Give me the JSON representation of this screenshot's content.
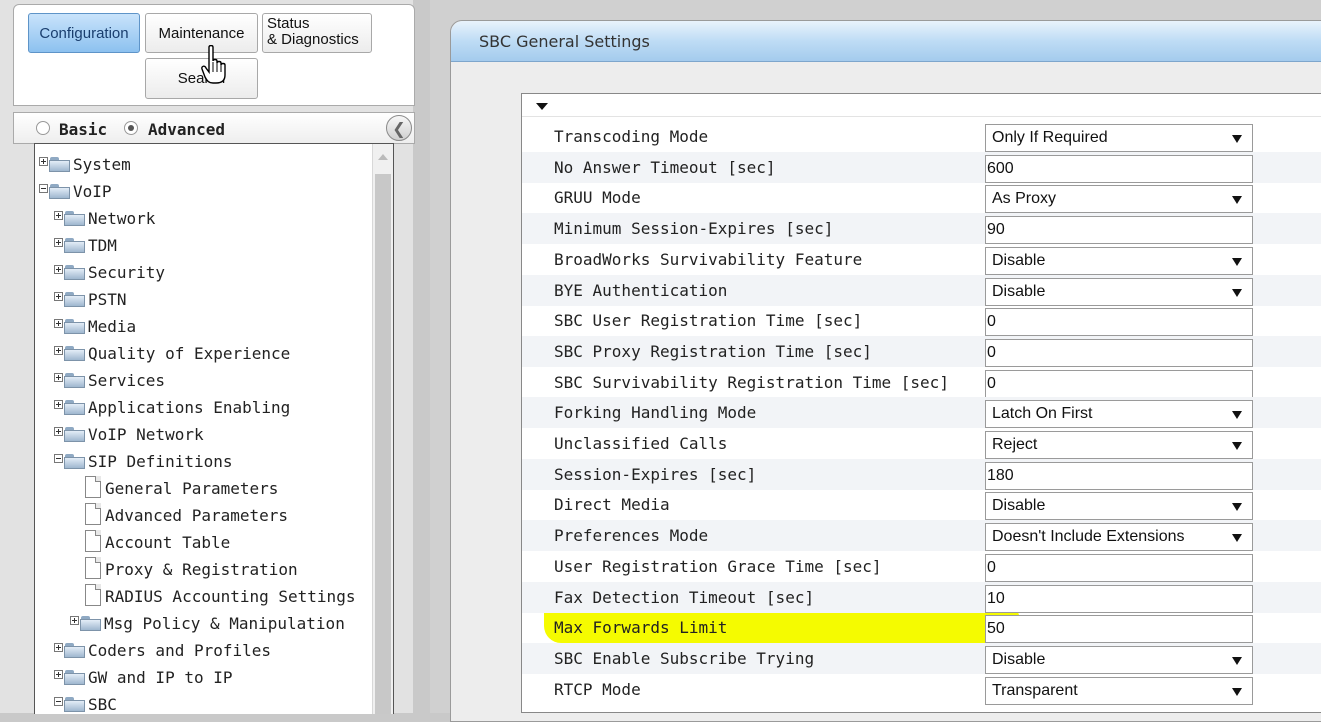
{
  "nav": {
    "configuration": "Configuration",
    "maintenance": "Maintenance",
    "status_line1": "Status",
    "status_line2": "& Diagnostics",
    "search": "Search"
  },
  "mode": {
    "basic": "Basic",
    "advanced": "Advanced",
    "selected": "Advanced"
  },
  "tree": {
    "items": [
      {
        "label": "System",
        "type": "folder",
        "expander": "plus",
        "level": 0
      },
      {
        "label": "VoIP",
        "type": "folder",
        "expander": "minus",
        "level": 0
      },
      {
        "label": "Network",
        "type": "folder",
        "expander": "plus",
        "level": 1
      },
      {
        "label": "TDM",
        "type": "folder",
        "expander": "plus",
        "level": 1
      },
      {
        "label": "Security",
        "type": "folder",
        "expander": "plus",
        "level": 1
      },
      {
        "label": "PSTN",
        "type": "folder",
        "expander": "plus",
        "level": 1
      },
      {
        "label": "Media",
        "type": "folder",
        "expander": "plus",
        "level": 1
      },
      {
        "label": "Quality of Experience",
        "type": "folder",
        "expander": "plus",
        "level": 1
      },
      {
        "label": "Services",
        "type": "folder",
        "expander": "plus",
        "level": 1
      },
      {
        "label": "Applications Enabling",
        "type": "folder",
        "expander": "plus",
        "level": 1
      },
      {
        "label": "VoIP Network",
        "type": "folder",
        "expander": "plus",
        "level": 1
      },
      {
        "label": "SIP Definitions",
        "type": "folder",
        "expander": "minus",
        "level": 1
      },
      {
        "label": "General Parameters",
        "type": "page",
        "level": 2
      },
      {
        "label": "Advanced Parameters",
        "type": "page",
        "level": 2
      },
      {
        "label": "Account Table",
        "type": "page",
        "level": 2
      },
      {
        "label": "Proxy & Registration",
        "type": "page",
        "level": 2
      },
      {
        "label": "RADIUS Accounting Settings",
        "type": "page",
        "level": 2
      },
      {
        "label": "Msg Policy & Manipulation",
        "type": "folder",
        "expander": "plus",
        "level": 2
      },
      {
        "label": "Coders and Profiles",
        "type": "folder",
        "expander": "plus",
        "level": 1
      },
      {
        "label": "GW and IP to IP",
        "type": "folder",
        "expander": "plus",
        "level": 1
      },
      {
        "label": "SBC",
        "type": "folder",
        "expander": "minus",
        "level": 1
      }
    ]
  },
  "settings": {
    "title": "SBC General Settings",
    "rows": [
      {
        "label": "Transcoding Mode",
        "control": "select",
        "value": "Only If Required"
      },
      {
        "label": "No Answer Timeout [sec]",
        "control": "input",
        "value": "600"
      },
      {
        "label": "GRUU Mode",
        "control": "select",
        "value": "As Proxy"
      },
      {
        "label": "Minimum Session-Expires [sec]",
        "control": "input",
        "value": "90"
      },
      {
        "label": "BroadWorks Survivability Feature",
        "control": "select",
        "value": "Disable"
      },
      {
        "label": "BYE Authentication",
        "control": "select",
        "value": "Disable"
      },
      {
        "label": "SBC User Registration Time [sec]",
        "control": "input",
        "value": "0"
      },
      {
        "label": "SBC Proxy Registration Time [sec]",
        "control": "input",
        "value": "0"
      },
      {
        "label": "SBC Survivability Registration Time [sec]",
        "control": "input",
        "value": "0"
      },
      {
        "label": "Forking Handling Mode",
        "control": "select",
        "value": "Latch On First"
      },
      {
        "label": "Unclassified Calls",
        "control": "select",
        "value": "Reject"
      },
      {
        "label": "Session-Expires [sec]",
        "control": "input",
        "value": "180"
      },
      {
        "label": "Direct Media",
        "control": "select",
        "value": "Disable"
      },
      {
        "label": "Preferences Mode",
        "control": "select",
        "value": "Doesn't Include Extensions"
      },
      {
        "label": "User Registration Grace Time [sec]",
        "control": "input",
        "value": "0"
      },
      {
        "label": "Fax Detection Timeout [sec]",
        "control": "input",
        "value": "10"
      },
      {
        "label": "Max Forwards Limit",
        "control": "input",
        "value": "50"
      },
      {
        "label": "SBC Enable Subscribe Trying",
        "control": "select",
        "value": "Disable"
      },
      {
        "label": "RTCP Mode",
        "control": "select",
        "value": "Transparent"
      }
    ]
  },
  "colors": {
    "active_tab": "#8cc1ef",
    "header_blue": "#a4cbed",
    "highlight": "#f5fb00"
  }
}
